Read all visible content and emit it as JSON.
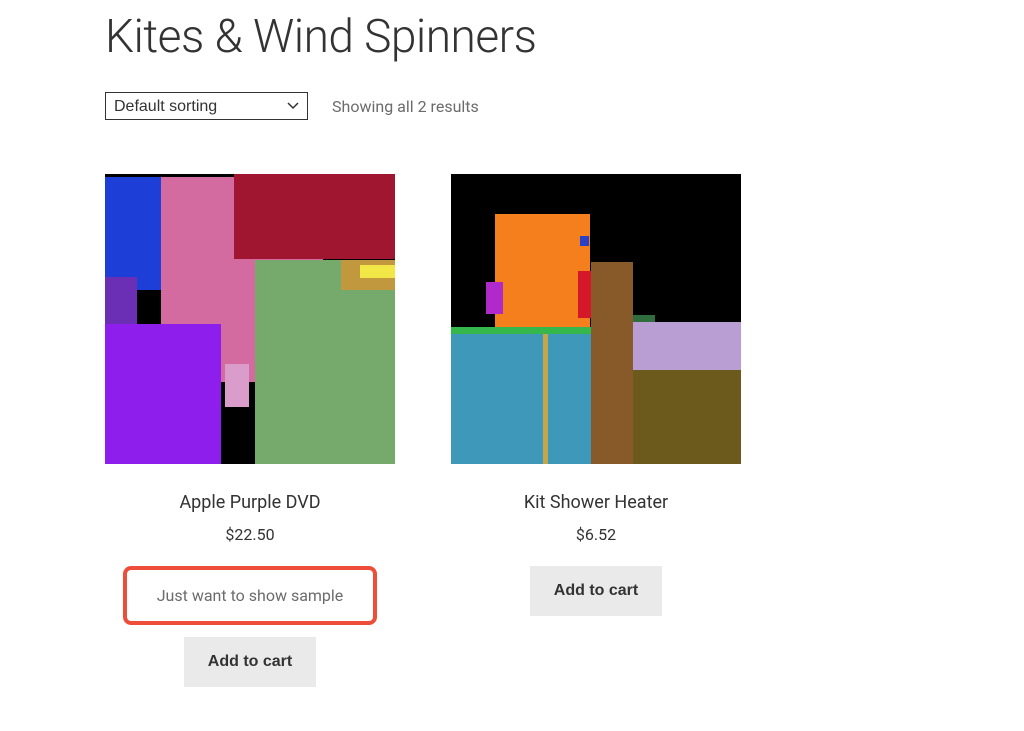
{
  "header": {
    "title": "Kites & Wind Spinners"
  },
  "sort": {
    "selected": "Default sorting"
  },
  "result_text": "Showing all 2 results",
  "products": [
    {
      "title": "Apple Purple DVD",
      "price": "$22.50",
      "sample_note": "Just want to show sample",
      "cta": "Add to cart"
    },
    {
      "title": "Kit Shower Heater",
      "price": "$6.52",
      "cta": "Add to cart"
    }
  ]
}
